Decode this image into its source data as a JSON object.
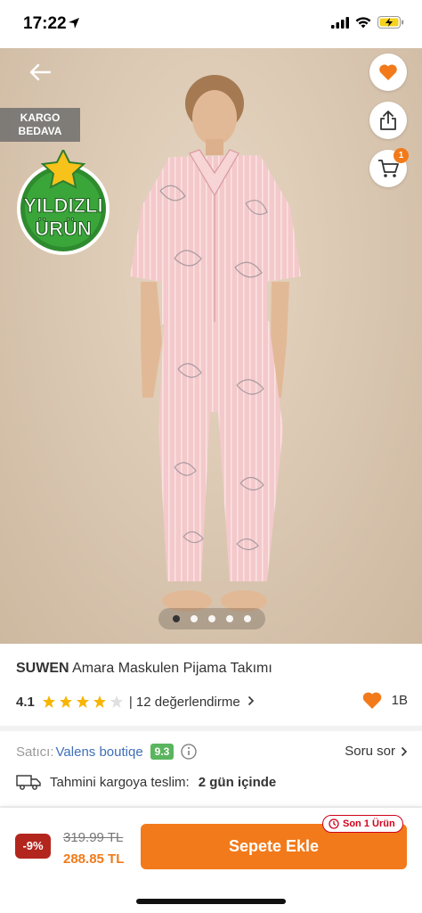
{
  "status": {
    "time": "17:22"
  },
  "badges": {
    "kargo_line1": "KARGO",
    "kargo_line2": "BEDAVA",
    "yildizli_line1": "YILDIZLI",
    "yildizli_line2": "ÜRÜN"
  },
  "cart": {
    "count": "1"
  },
  "gallery": {
    "total_images": 5,
    "active_index": 0
  },
  "product": {
    "brand": "SUWEN",
    "name": "Amara Maskulen Pijama Takımı",
    "rating": "4.1",
    "stars_filled": 4,
    "reviews": "| 12 değerlendirme",
    "favorites": "1B"
  },
  "seller": {
    "label": "Satıcı:",
    "name": "Valens boutiqe",
    "score": "9.3",
    "ask": "Soru sor"
  },
  "shipping": {
    "label": "Tahmini kargoya teslim:",
    "value": "2 gün içinde"
  },
  "purchase": {
    "discount": "-9%",
    "old_price": "319.99 TL",
    "new_price": "288.85 TL",
    "add_to_cart": "Sepete Ekle",
    "stock_badge": "Son 1 Ürün"
  },
  "colors": {
    "accent": "#f27a1a",
    "discount": "#b3261e",
    "seller_link": "#3f6fb6",
    "score": "#5ab55e",
    "pink": "#f2c4c8"
  }
}
